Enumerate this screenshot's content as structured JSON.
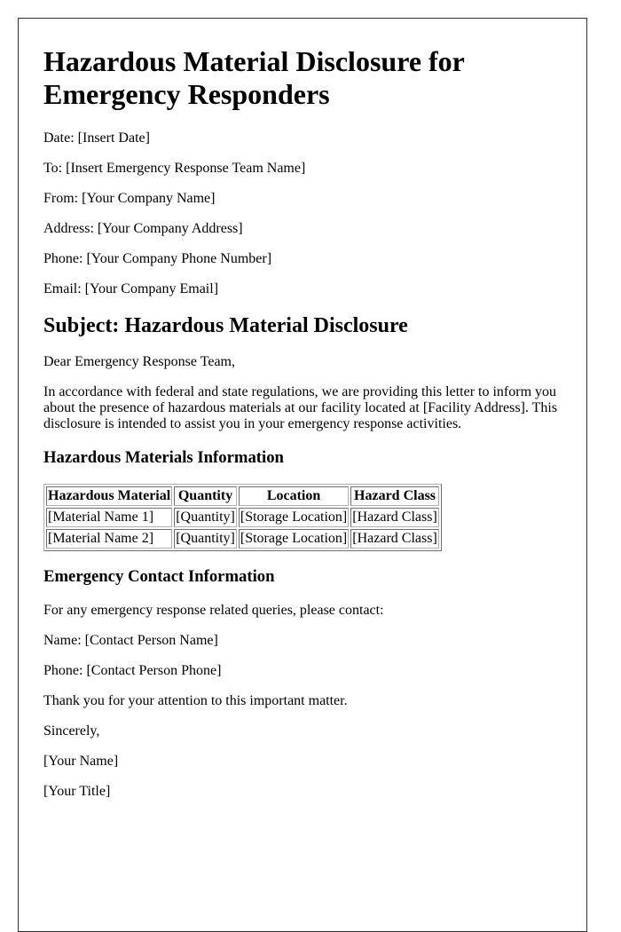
{
  "document": {
    "title": "Hazardous Material Disclosure for Emergency Responders",
    "header_fields": [
      {
        "label": "Date:",
        "value": "[Insert Date]"
      },
      {
        "label": "To:",
        "value": "[Insert Emergency Response Team Name]"
      },
      {
        "label": "From:",
        "value": "[Your Company Name]"
      },
      {
        "label": "Address:",
        "value": "[Your Company Address]"
      },
      {
        "label": "Phone:",
        "value": "[Your Company Phone Number]"
      },
      {
        "label": "Email:",
        "value": "[Your Company Email]"
      }
    ],
    "subject": "Subject: Hazardous Material Disclosure",
    "salutation": "Dear Emergency Response Team,",
    "intro_paragraph": "In accordance with federal and state regulations, we are providing this letter to inform you about the presence of hazardous materials at our facility located at [Facility Address]. This disclosure is intended to assist you in your emergency response activities.",
    "materials_section": {
      "heading": "Hazardous Materials Information",
      "table": {
        "headers": [
          "Hazardous Material",
          "Quantity",
          "Location",
          "Hazard Class"
        ],
        "rows": [
          [
            "[Material Name 1]",
            "[Quantity]",
            "[Storage Location]",
            "[Hazard Class]"
          ],
          [
            "[Material Name 2]",
            "[Quantity]",
            "[Storage Location]",
            "[Hazard Class]"
          ]
        ]
      }
    },
    "contact_section": {
      "heading": "Emergency Contact Information",
      "intro": "For any emergency response related queries, please contact:",
      "fields": [
        {
          "label": "Name:",
          "value": "[Contact Person Name]"
        },
        {
          "label": "Phone:",
          "value": "[Contact Person Phone]"
        }
      ]
    },
    "closing_line": "Thank you for your attention to this important matter.",
    "sign_off": "Sincerely,",
    "signature_name": "[Your Name]",
    "signature_title": "[Your Title]"
  }
}
